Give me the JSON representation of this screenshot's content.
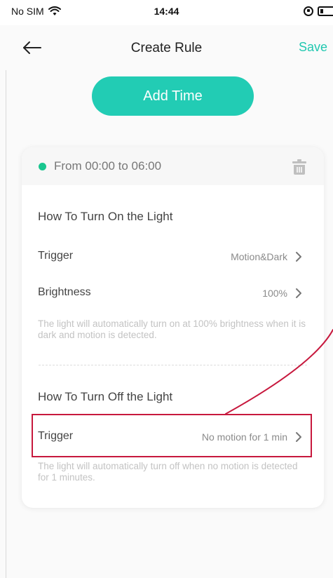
{
  "status_bar": {
    "carrier": "No SIM",
    "time": "14:44",
    "icons": [
      "wifi-icon",
      "rotation-lock-icon",
      "battery-icon"
    ]
  },
  "header": {
    "title": "Create Rule",
    "save_label": "Save",
    "back_icon": "back-arrow-icon"
  },
  "add_time": {
    "label": "Add Time"
  },
  "rule": {
    "time_range": "From 00:00 to 06:00",
    "delete_icon": "trash-icon",
    "turn_on": {
      "title": "How To Turn On the Light",
      "rows": [
        {
          "label": "Trigger",
          "value": "Motion&Dark"
        },
        {
          "label": "Brightness",
          "value": "100%"
        }
      ],
      "description": "The light will automatically turn on at 100% brightness when it is dark and motion is detected."
    },
    "turn_off": {
      "title": "How To Turn Off the Light",
      "rows": [
        {
          "label": "Trigger",
          "value": "No motion for 1 min"
        }
      ],
      "description": "The light will automatically turn off when no motion is detected for 1 minutes."
    }
  },
  "colors": {
    "accent": "#22ccb4",
    "save_text": "#21c8b0",
    "status_dot": "#19c68f",
    "highlight": "#c7183d"
  }
}
